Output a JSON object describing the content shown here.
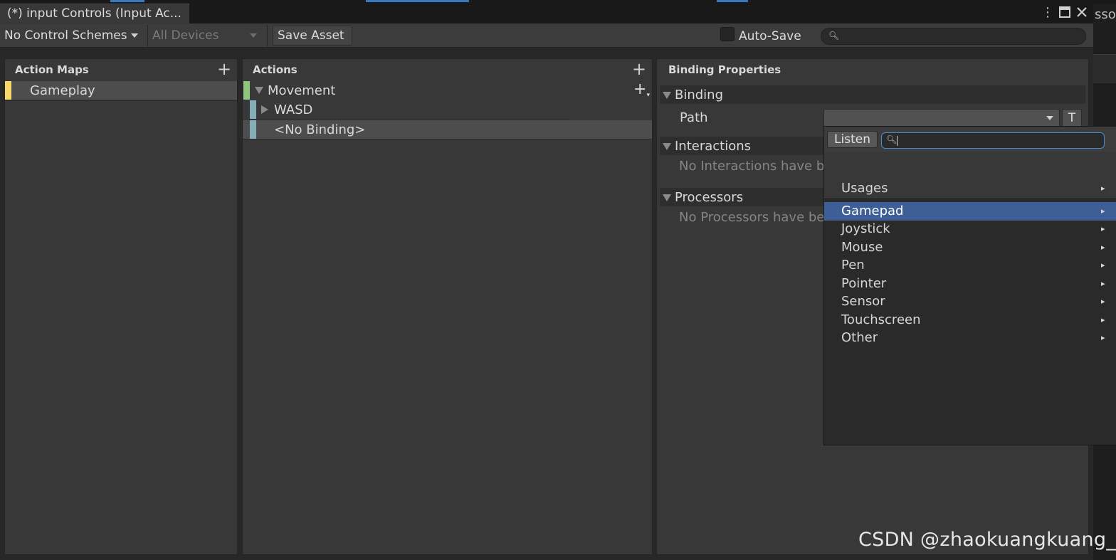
{
  "window": {
    "tab_title": "(*) input Controls (Input Ac...",
    "menu_icon": "kebab-menu-icon",
    "maximize_icon": "maximize-icon",
    "close_icon": "close-icon"
  },
  "toolbar": {
    "control_schemes": "No Control Schemes",
    "devices": "All Devices",
    "save_asset": "Save Asset",
    "auto_save_label": "Auto-Save",
    "auto_save_checked": false,
    "search_value": ""
  },
  "action_maps": {
    "header": "Action Maps",
    "items": [
      {
        "label": "Gameplay",
        "accent": "#f6d86b"
      }
    ]
  },
  "actions": {
    "header": "Actions",
    "items": [
      {
        "label": "Movement",
        "accent": "#8fc67f"
      },
      {
        "label": "WASD",
        "accent": "#86aeb9"
      },
      {
        "label": "<No Binding>",
        "accent": "#86aeb9"
      }
    ]
  },
  "binding_properties": {
    "header": "Binding Properties",
    "binding_section": "Binding",
    "path_label": "Path",
    "path_value": "",
    "t_button": "T",
    "interactions_section": "Interactions",
    "interactions_empty": "No Interactions have be",
    "processors_section": "Processors",
    "processors_empty": "No Processors have bee"
  },
  "path_popup": {
    "listen_button": "Listen",
    "search_value": "",
    "items": [
      {
        "label": "Usages",
        "selected": false
      },
      {
        "label": "Gamepad",
        "selected": true
      },
      {
        "label": "Joystick",
        "selected": false
      },
      {
        "label": "Mouse",
        "selected": false
      },
      {
        "label": "Pen",
        "selected": false
      },
      {
        "label": "Pointer",
        "selected": false
      },
      {
        "label": "Sensor",
        "selected": false
      },
      {
        "label": "Touchscreen",
        "selected": false
      },
      {
        "label": "Other",
        "selected": false
      }
    ],
    "submenu_arrow": "▸"
  },
  "watermark": "CSDN @zhaokuangkuang_",
  "background_fragment": "sso",
  "colors": {
    "selection": "#3e5f96",
    "focus_border": "#4c8cd6",
    "panel_bg": "#383838"
  }
}
